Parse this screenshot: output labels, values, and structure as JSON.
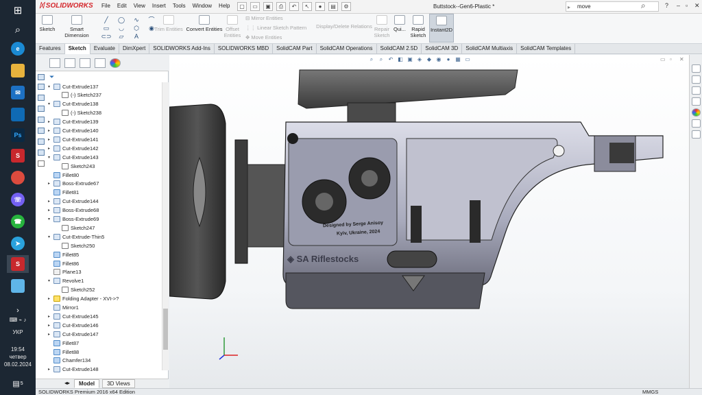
{
  "taskbar": {
    "language": "УКР",
    "time": "19:54",
    "day": "четвер",
    "date": "08.02.2024",
    "notification_count": "5"
  },
  "app": {
    "brand": "SOLIDWORKS",
    "menu": [
      "File",
      "Edit",
      "View",
      "Insert",
      "Tools",
      "Window",
      "Help"
    ],
    "doc_title": "Buttstock--Gen6-Plastic *",
    "search_value": "move"
  },
  "ribbon": {
    "sketch": "Sketch",
    "smart_dimension_1": "Smart",
    "smart_dimension_2": "Dimension",
    "trim": "Trim Entities",
    "convert": "Convert Entities",
    "offset_1": "Offset",
    "offset_2": "Entities",
    "mirror": "Mirror Entities",
    "linear_pattern": "Linear Sketch Pattern",
    "move": "Move Entities",
    "display_delete": "Display/Delete Relations",
    "repair_1": "Repair",
    "repair_2": "Sketch",
    "quick": "Qui...",
    "rapid_1": "Rapid",
    "rapid_2": "Sketch",
    "instant2d": "Instant2D"
  },
  "tabs": [
    "Features",
    "Sketch",
    "Evaluate",
    "DimXpert",
    "SOLIDWORKS Add-Ins",
    "SOLIDWORKS MBD",
    "SolidCAM Part",
    "SolidCAM Operations",
    "SolidCAM 2.5D",
    "SolidCAM 3D",
    "SolidCAM Multiaxis",
    "SolidCAM Templates"
  ],
  "tree": [
    {
      "label": "Cut-Extrude137",
      "indent": 0,
      "kind": "cut",
      "exp": "▾"
    },
    {
      "label": "(-) Sketch237",
      "indent": 1,
      "kind": "sketch",
      "exp": ""
    },
    {
      "label": "Cut-Extrude138",
      "indent": 0,
      "kind": "cut",
      "exp": "▾"
    },
    {
      "label": "(-) Sketch238",
      "indent": 1,
      "kind": "sketch",
      "exp": ""
    },
    {
      "label": "Cut-Extrude139",
      "indent": 0,
      "kind": "cut",
      "exp": "▸"
    },
    {
      "label": "Cut-Extrude140",
      "indent": 0,
      "kind": "cut",
      "exp": "▸"
    },
    {
      "label": "Cut-Extrude141",
      "indent": 0,
      "kind": "cut",
      "exp": "▸"
    },
    {
      "label": "Cut-Extrude142",
      "indent": 0,
      "kind": "cut",
      "exp": "▸"
    },
    {
      "label": "Cut-Extrude143",
      "indent": 0,
      "kind": "cut",
      "exp": "▾"
    },
    {
      "label": "Sketch243",
      "indent": 1,
      "kind": "sketch",
      "exp": ""
    },
    {
      "label": "Fillet80",
      "indent": 0,
      "kind": "fillet",
      "exp": ""
    },
    {
      "label": "Boss-Extrude67",
      "indent": 0,
      "kind": "cut",
      "exp": "▸"
    },
    {
      "label": "Fillet81",
      "indent": 0,
      "kind": "fillet",
      "exp": ""
    },
    {
      "label": "Cut-Extrude144",
      "indent": 0,
      "kind": "cut",
      "exp": "▸"
    },
    {
      "label": "Boss-Extrude68",
      "indent": 0,
      "kind": "cut",
      "exp": "▸"
    },
    {
      "label": "Boss-Extrude69",
      "indent": 0,
      "kind": "cut",
      "exp": "▾"
    },
    {
      "label": "Sketch247",
      "indent": 1,
      "kind": "sketch",
      "exp": ""
    },
    {
      "label": "Cut-Extrude-Thin5",
      "indent": 0,
      "kind": "cut",
      "exp": "▾"
    },
    {
      "label": "Sketch250",
      "indent": 1,
      "kind": "sketch",
      "exp": ""
    },
    {
      "label": "Fillet85",
      "indent": 0,
      "kind": "fillet",
      "exp": ""
    },
    {
      "label": "Fillet86",
      "indent": 0,
      "kind": "fillet",
      "exp": ""
    },
    {
      "label": "Plane13",
      "indent": 0,
      "kind": "plane",
      "exp": ""
    },
    {
      "label": "Revolve1",
      "indent": 0,
      "kind": "cut",
      "exp": "▾"
    },
    {
      "label": "Sketch252",
      "indent": 1,
      "kind": "sketch",
      "exp": ""
    },
    {
      "label": "Folding Adapter - XVI->?",
      "indent": 0,
      "kind": "folder",
      "exp": "▸"
    },
    {
      "label": "Mirror1",
      "indent": 0,
      "kind": "cut",
      "exp": ""
    },
    {
      "label": "Cut-Extrude145",
      "indent": 0,
      "kind": "cut",
      "exp": "▸"
    },
    {
      "label": "Cut-Extrude146",
      "indent": 0,
      "kind": "cut",
      "exp": "▸"
    },
    {
      "label": "Cut-Extrude147",
      "indent": 0,
      "kind": "cut",
      "exp": "▸"
    },
    {
      "label": "Fillet87",
      "indent": 0,
      "kind": "fillet",
      "exp": ""
    },
    {
      "label": "Fillet88",
      "indent": 0,
      "kind": "fillet",
      "exp": ""
    },
    {
      "label": "Chamfer134",
      "indent": 0,
      "kind": "fillet",
      "exp": ""
    },
    {
      "label": "Cut-Extrude148",
      "indent": 0,
      "kind": "cut",
      "exp": "▸"
    }
  ],
  "fm_bottom": {
    "model": "Model",
    "views": "3D Views"
  },
  "viewport": {
    "engraving_1": "Designed by Serge Anisoy",
    "engraving_2": "Kyiv, Ukraine, 2024",
    "brand_mark": "SA Riflestocks"
  },
  "status": {
    "edition": "SOLIDWORKS Premium 2016 x64 Edition",
    "units": "MMGS"
  }
}
